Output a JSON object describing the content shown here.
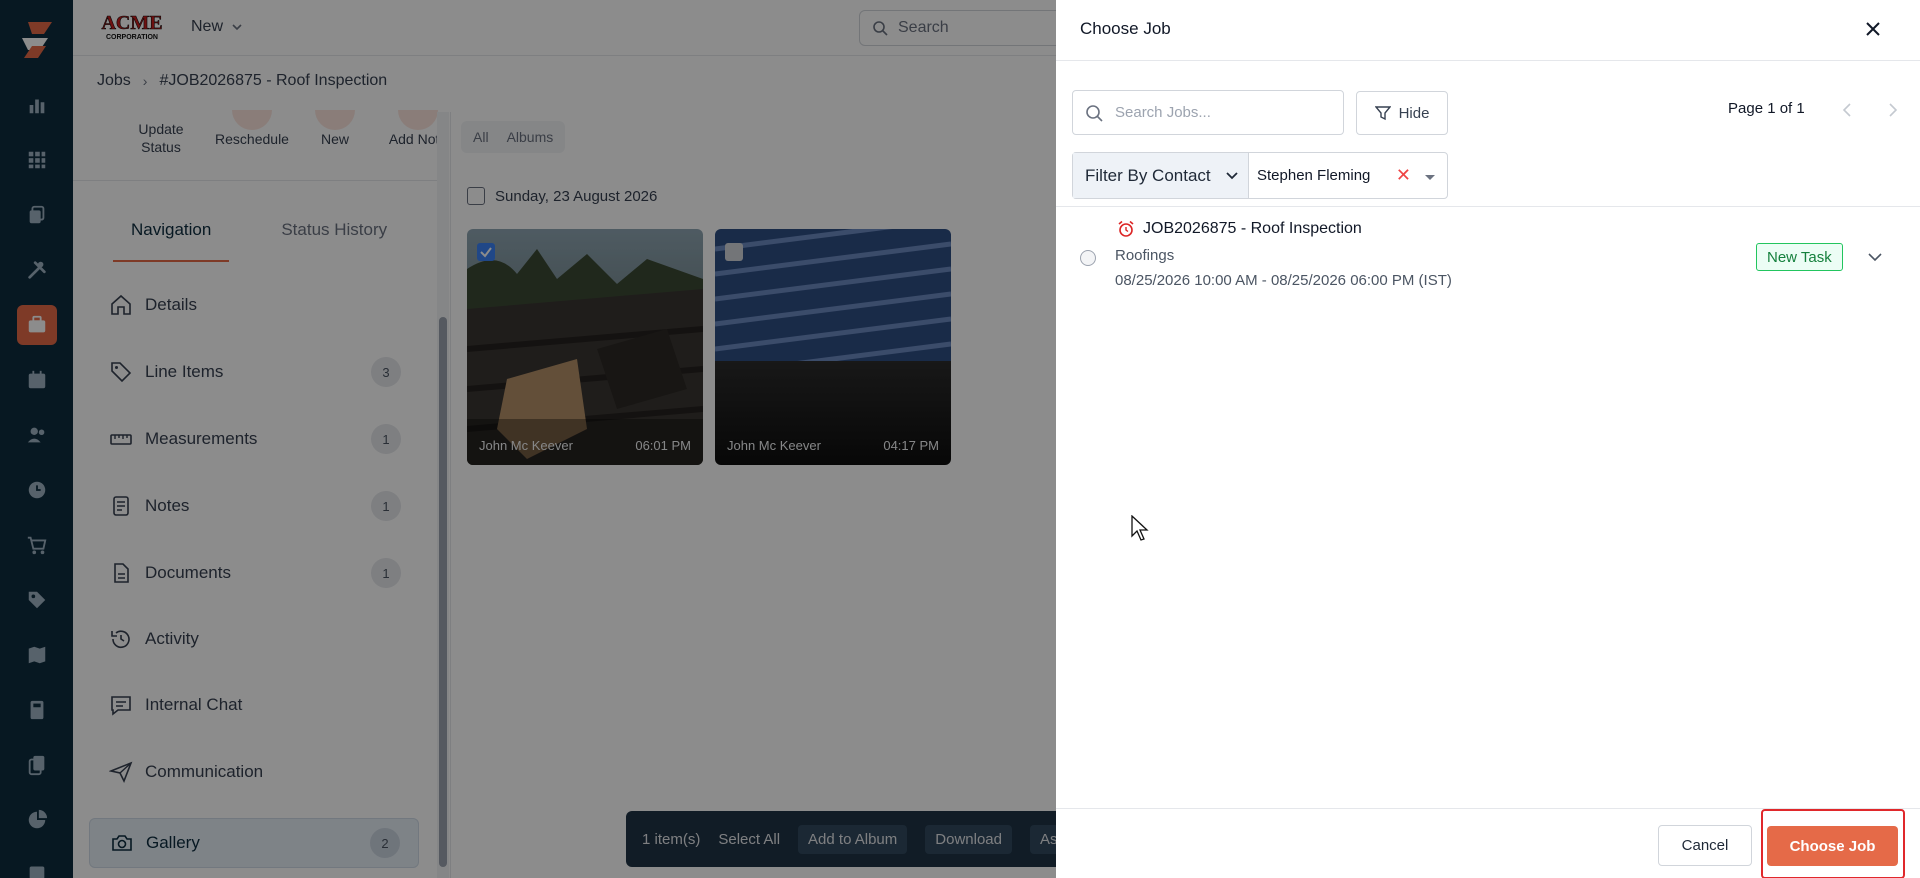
{
  "topbar": {
    "brand_name": "ACME CORPORATION",
    "new_label": "New",
    "search_placeholder": "Search"
  },
  "breadcrumb": {
    "root": "Jobs",
    "current": "#JOB2026875 - Roof Inspection"
  },
  "quick_actions": [
    "Update Status",
    "Reschedule",
    "New",
    "Add Note"
  ],
  "panel_tabs": [
    {
      "label": "Navigation",
      "active": true
    },
    {
      "label": "Status History",
      "active": false
    }
  ],
  "nav_items": [
    {
      "label": "Details",
      "icon": "home-icon",
      "count": null
    },
    {
      "label": "Line Items",
      "icon": "tag-icon",
      "count": "3"
    },
    {
      "label": "Measurements",
      "icon": "ruler-icon",
      "count": "1"
    },
    {
      "label": "Notes",
      "icon": "notes-icon",
      "count": "1"
    },
    {
      "label": "Documents",
      "icon": "document-icon",
      "count": "1"
    },
    {
      "label": "Activity",
      "icon": "history-icon",
      "count": null
    },
    {
      "label": "Internal Chat",
      "icon": "chat-icon",
      "count": null
    },
    {
      "label": "Communication",
      "icon": "send-icon",
      "count": null
    },
    {
      "label": "Gallery",
      "icon": "camera-icon",
      "count": "2",
      "active": true
    }
  ],
  "gallery": {
    "tabs": [
      "All",
      "Albums"
    ],
    "date_label": "Sunday, 23 August 2026",
    "photos": [
      {
        "author": "John Mc Keever",
        "time": "06:01 PM",
        "checked": true
      },
      {
        "author": "John Mc Keever",
        "time": "04:17 PM",
        "checked": false
      }
    ],
    "bottom_bar": {
      "selected_count": "1 item(s)",
      "select_all": "Select All",
      "add_to_album": "Add to Album",
      "download": "Download",
      "assign": "Ass"
    }
  },
  "drawer": {
    "title": "Choose Job",
    "search_placeholder": "Search Jobs...",
    "hide_label": "Hide",
    "page_info": "Page 1 of 1",
    "filter_label": "Filter By Contact",
    "filter_value": "Stephen Fleming",
    "jobs": [
      {
        "title": "JOB2026875 - Roof Inspection",
        "type": "Roofings",
        "time_range": "08/25/2026 10:00 AM - 08/25/2026 06:00 PM (IST)",
        "status": "New Task"
      }
    ],
    "cancel_label": "Cancel",
    "choose_label": "Choose Job"
  },
  "colors": {
    "rail_bg": "#0d2d3f",
    "accent": "#e56a48",
    "badge_green": "#22c55e",
    "highlight_red": "#e0282b"
  }
}
